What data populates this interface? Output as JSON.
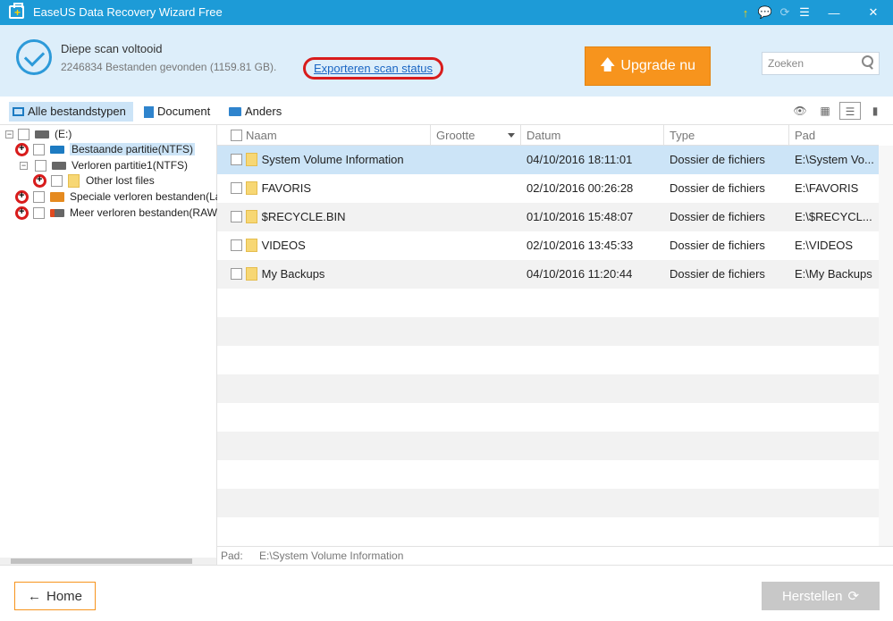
{
  "window": {
    "title": "EaseUS Data Recovery Wizard Free",
    "controls": [
      "↑",
      "💬",
      "⟳",
      "☰",
      "—",
      "✕"
    ]
  },
  "header": {
    "scan_title": "Diepe scan voltooid",
    "scan_summary": "2246834 Bestanden gevonden (1159.81 GB).",
    "export_link": "Exporteren scan status",
    "upgrade_label": "Upgrade nu",
    "search_placeholder": "Zoeken"
  },
  "filters": {
    "all": "Alle bestandstypen",
    "document": "Document",
    "others": "Anders"
  },
  "tree": {
    "drive": "(E:)",
    "existing": "Bestaande partitie(NTFS)",
    "lost1": "Verloren partitie1(NTFS)",
    "other_lost": "Other lost files",
    "special": "Speciale verloren bestanden(Lab",
    "more": "Meer verloren bestanden(RAW)"
  },
  "grid": {
    "columns": {
      "name": "Naam",
      "size": "Grootte",
      "date": "Datum",
      "type": "Type",
      "path": "Pad"
    },
    "rows": [
      {
        "name": "System Volume Information",
        "size": "",
        "date": "04/10/2016 18:11:01",
        "type": "Dossier de fichiers",
        "path": "E:\\System Vo..."
      },
      {
        "name": "FAVORIS",
        "size": "",
        "date": "02/10/2016 00:26:28",
        "type": "Dossier de fichiers",
        "path": "E:\\FAVORIS"
      },
      {
        "name": "$RECYCLE.BIN",
        "size": "",
        "date": "01/10/2016 15:48:07",
        "type": "Dossier de fichiers",
        "path": "E:\\$RECYCL..."
      },
      {
        "name": "VIDEOS",
        "size": "",
        "date": "02/10/2016 13:45:33",
        "type": "Dossier de fichiers",
        "path": "E:\\VIDEOS"
      },
      {
        "name": "My Backups",
        "size": "",
        "date": "04/10/2016 11:20:44",
        "type": "Dossier de fichiers",
        "path": "E:\\My Backups"
      }
    ]
  },
  "pathbar": {
    "label": "Pad:",
    "value": "E:\\System Volume Information"
  },
  "footer": {
    "home": "Home",
    "restore": "Herstellen"
  }
}
